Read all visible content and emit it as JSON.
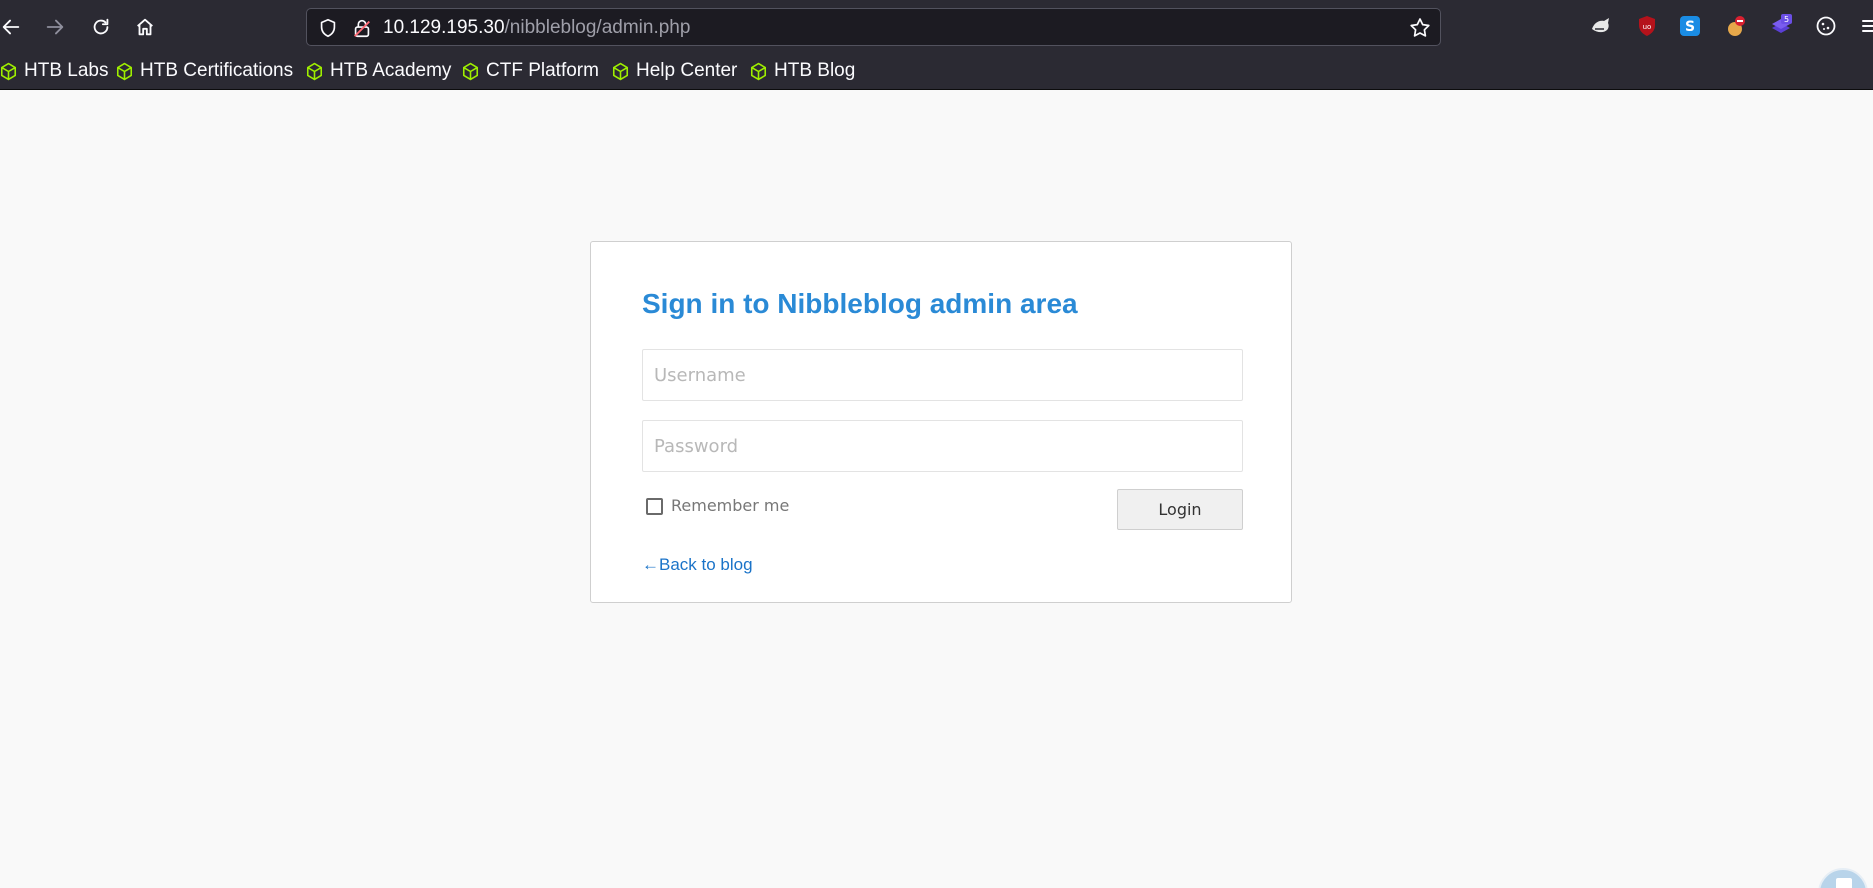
{
  "browser": {
    "url_host": "10.129.195.30",
    "url_path": "/nibbleblog/admin.php",
    "extension_badge": "5"
  },
  "bookmarks": [
    {
      "label": "HTB Labs"
    },
    {
      "label": "HTB Certifications"
    },
    {
      "label": "HTB Academy"
    },
    {
      "label": "CTF Platform"
    },
    {
      "label": "Help Center"
    },
    {
      "label": "HTB Blog"
    }
  ],
  "login": {
    "title": "Sign in to Nibbleblog admin area",
    "username_placeholder": "Username",
    "username_value": "",
    "password_placeholder": "Password",
    "password_value": "",
    "remember_label": "Remember me",
    "login_button": "Login",
    "back_link": "←Back to blog"
  },
  "colors": {
    "chrome": "#2b2a33",
    "title_blue": "#2a8ad6",
    "bookmark_icon_green": "#9fef00"
  }
}
